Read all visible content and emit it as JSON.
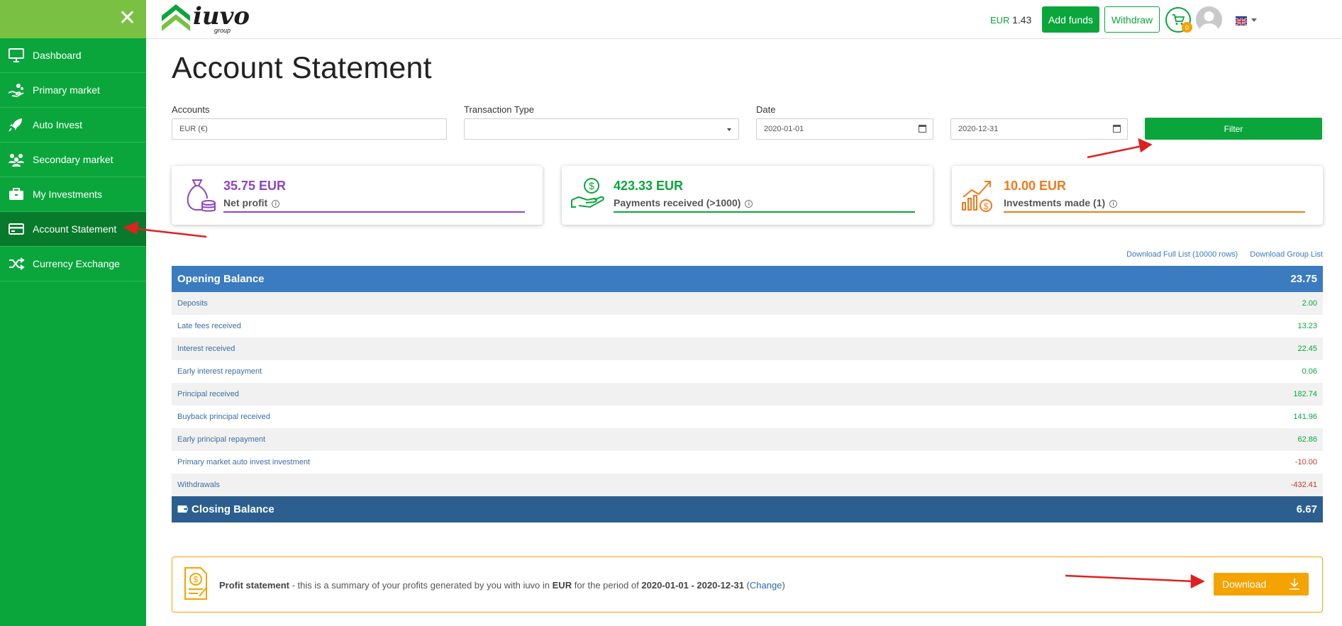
{
  "sidebar": {
    "items": [
      {
        "label": "Dashboard",
        "icon": "monitor-icon",
        "active": false
      },
      {
        "label": "Primary market",
        "icon": "hand-coins-icon",
        "active": false
      },
      {
        "label": "Auto Invest",
        "icon": "rocket-icon",
        "active": false
      },
      {
        "label": "Secondary market",
        "icon": "people-icon",
        "active": false
      },
      {
        "label": "My Investments",
        "icon": "briefcase-icon",
        "active": false
      },
      {
        "label": "Account Statement",
        "icon": "card-icon",
        "active": true
      },
      {
        "label": "Currency Exchange",
        "icon": "shuffle-icon",
        "active": false
      }
    ]
  },
  "header": {
    "logo_text": "iuvo",
    "logo_sub": "group",
    "balance_currency": "EUR",
    "balance_amount": "1.43",
    "add_funds_label": "Add funds",
    "withdraw_label": "Withdraw",
    "cart_count": "0"
  },
  "page": {
    "title": "Account Statement"
  },
  "filters": {
    "accounts_label": "Accounts",
    "accounts_value": "EUR (€)",
    "transaction_type_label": "Transaction Type",
    "transaction_type_value": "",
    "date_label": "Date",
    "date_from": "2020-01-01",
    "date_to": "2020-12-31",
    "filter_label": "Filter"
  },
  "cards": [
    {
      "value": "35.75 EUR",
      "label": "Net profit",
      "color": "#8e44c4"
    },
    {
      "value": "423.33 EUR",
      "label": "Payments received (>1000)",
      "color": "#0aa63c"
    },
    {
      "value": "10.00 EUR",
      "label": "Investments made (1)",
      "color": "#f07a1a"
    }
  ],
  "download_links": {
    "full": "Download Full List (10000 rows)",
    "group": "Download Group List"
  },
  "statement": {
    "opening_label": "Opening Balance",
    "opening_value": "23.75",
    "rows": [
      {
        "label": "Deposits",
        "value": "2.00"
      },
      {
        "label": "Late fees received",
        "value": "13.23"
      },
      {
        "label": "Interest received",
        "value": "22.45"
      },
      {
        "label": "Early interest repayment",
        "value": "0.06"
      },
      {
        "label": "Principal received",
        "value": "182.74"
      },
      {
        "label": "Buyback principal received",
        "value": "141.96"
      },
      {
        "label": "Early principal repayment",
        "value": "62.86"
      },
      {
        "label": "Primary market auto invest investment",
        "value": "-10.00"
      },
      {
        "label": "Withdrawals",
        "value": "-432.41"
      }
    ],
    "closing_label": "Closing Balance",
    "closing_value": "6.67"
  },
  "profit_statement": {
    "title": "Profit statement",
    "text1": " - this is a summary of your profits generated by you with iuvo in ",
    "currency": "EUR",
    "text2": " for the period of ",
    "period": "2020-01-01 - 2020-12-31",
    "change_link": "Change",
    "download_label": "Download"
  },
  "colors": {
    "green": "#0aa63c",
    "light_green": "#7ac143",
    "blue": "#3b7bbf",
    "dark_blue": "#2c5f8f",
    "orange": "#f4a300",
    "annotation_red": "#e02020"
  }
}
